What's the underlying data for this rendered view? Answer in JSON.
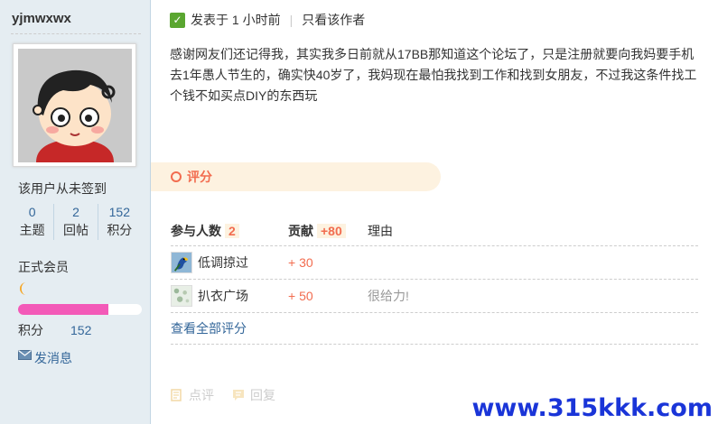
{
  "user": {
    "name": "yjmwxwx",
    "sign_status": "该用户从未签到",
    "stats": [
      {
        "value": "0",
        "label": "主题"
      },
      {
        "value": "2",
        "label": "回帖"
      },
      {
        "value": "152",
        "label": "积分"
      }
    ],
    "rank": "正式会员",
    "level_progress_pct": 73,
    "points_label": "积分",
    "points_value": "152",
    "send_message": "发消息",
    "colors": {
      "progress": "#f35ab8",
      "link": "#336699"
    }
  },
  "post": {
    "posted_time": "发表于 1 小时前",
    "separator": "|",
    "only_author": "只看该作者",
    "content_lines": [
      "感谢网友们还记得我，其实我多日前就从17BB那知道这个论坛了，只是注册就要向我妈要手机",
      "去1年愚人节生的，确实快40岁了，我妈现在最怕我找到工作和找到女朋友，不过我这条件找工",
      "个钱不如买点DIY的东西玩"
    ]
  },
  "rating": {
    "title": "评分",
    "headers": {
      "participants": "参与人数",
      "participants_count": "2",
      "contribution": "贡献",
      "contribution_total": "+80",
      "reason": "理由"
    },
    "rows": [
      {
        "user": "低调掠过",
        "score": "+ 30",
        "reason": "",
        "avatar_icon": "parrot-avatar-icon"
      },
      {
        "user": "扒衣广场",
        "score": "+ 50",
        "reason": "很给力!",
        "avatar_icon": "pattern-avatar-icon"
      }
    ],
    "view_all": "查看全部评分",
    "accent": "#f26c4f"
  },
  "actions": {
    "comment": "点评",
    "reply": "回复"
  },
  "watermark": "www.315kkk.com"
}
